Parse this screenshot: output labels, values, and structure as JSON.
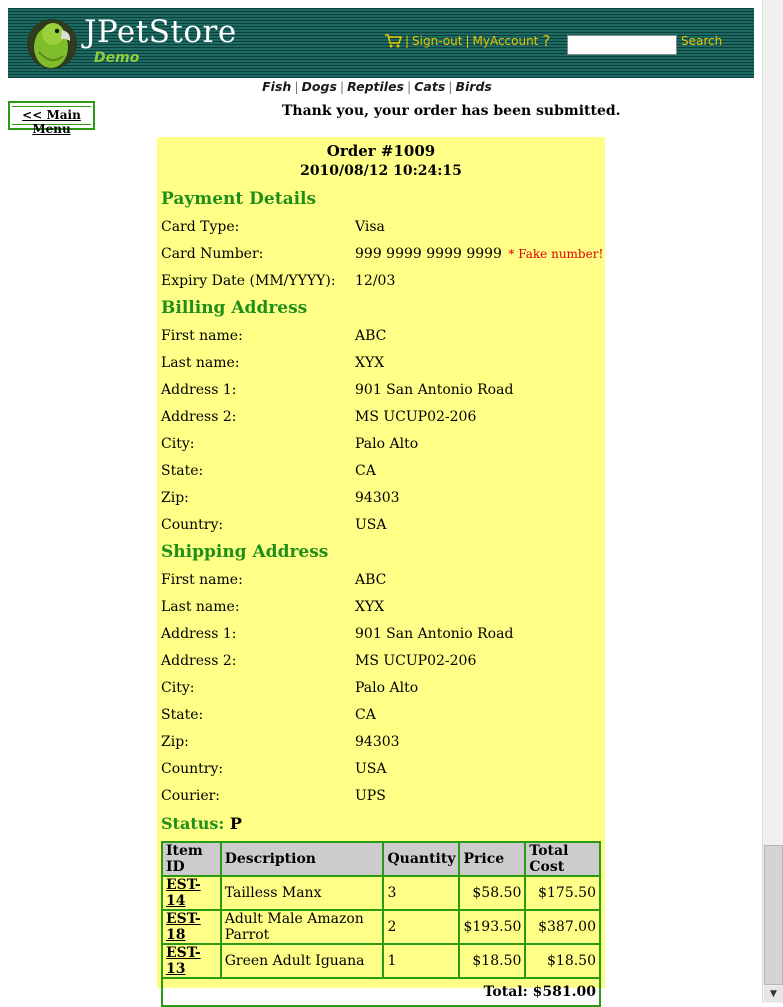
{
  "header": {
    "logo_text": "JPetStore",
    "logo_sub": "Demo",
    "signout_label": "Sign-out",
    "myaccount_label": "MyAccount",
    "help_label": "?",
    "search_value": "",
    "search_label": "Search"
  },
  "nav": {
    "categories": [
      "Fish",
      "Dogs",
      "Reptiles",
      "Cats",
      "Birds"
    ]
  },
  "main_menu_label": "<< Main Menu",
  "message": "Thank you, your order has been submitted.",
  "order": {
    "title": "Order #1009",
    "date": "2010/08/12 10:24:15",
    "payment": {
      "heading": "Payment Details",
      "fields": [
        {
          "label": "Card Type:",
          "value": "Visa"
        },
        {
          "label": "Card Number:",
          "value": "999 9999 9999 9999",
          "note": "* Fake number!"
        },
        {
          "label": "Expiry Date (MM/YYYY):",
          "value": "12/03"
        }
      ]
    },
    "billing": {
      "heading": "Billing Address",
      "fields": [
        {
          "label": "First name:",
          "value": "ABC"
        },
        {
          "label": "Last name:",
          "value": "XYX"
        },
        {
          "label": "Address 1:",
          "value": "901 San Antonio Road"
        },
        {
          "label": "Address 2:",
          "value": "MS UCUP02-206"
        },
        {
          "label": "City:",
          "value": "Palo Alto"
        },
        {
          "label": "State:",
          "value": "CA"
        },
        {
          "label": "Zip:",
          "value": "94303"
        },
        {
          "label": "Country:",
          "value": "USA"
        }
      ]
    },
    "shipping": {
      "heading": "Shipping Address",
      "fields": [
        {
          "label": "First name:",
          "value": "ABC"
        },
        {
          "label": "Last name:",
          "value": "XYX"
        },
        {
          "label": "Address 1:",
          "value": "901 San Antonio Road"
        },
        {
          "label": "Address 2:",
          "value": "MS UCUP02-206"
        },
        {
          "label": "City:",
          "value": "Palo Alto"
        },
        {
          "label": "State:",
          "value": "CA"
        },
        {
          "label": "Zip:",
          "value": "94303"
        },
        {
          "label": "Country:",
          "value": "USA"
        },
        {
          "label": "Courier:",
          "value": "UPS"
        }
      ]
    },
    "status_label": "Status:",
    "status_value": "P",
    "items_table": {
      "headers": [
        "Item ID",
        "Description",
        "Quantity",
        "Price",
        "Total Cost"
      ],
      "rows": [
        {
          "item_id": "EST-14",
          "description": "Tailless Manx",
          "quantity": "3",
          "price": "$58.50",
          "total": "$175.50"
        },
        {
          "item_id": "EST-18",
          "description": "Adult Male Amazon Parrot",
          "quantity": "2",
          "price": "$193.50",
          "total": "$387.00"
        },
        {
          "item_id": "EST-13",
          "description": "Green Adult Iguana",
          "quantity": "1",
          "price": "$18.50",
          "total": "$18.50"
        }
      ],
      "grand_total": "Total: $581.00"
    }
  },
  "colors": {
    "header_bg": "#0e4f4a",
    "link_yellow": "#e8c400",
    "panel_bg": "#ffff88",
    "section_green": "#1f8f1a",
    "border_green": "#2a9a12",
    "fake_red": "#e00000"
  }
}
